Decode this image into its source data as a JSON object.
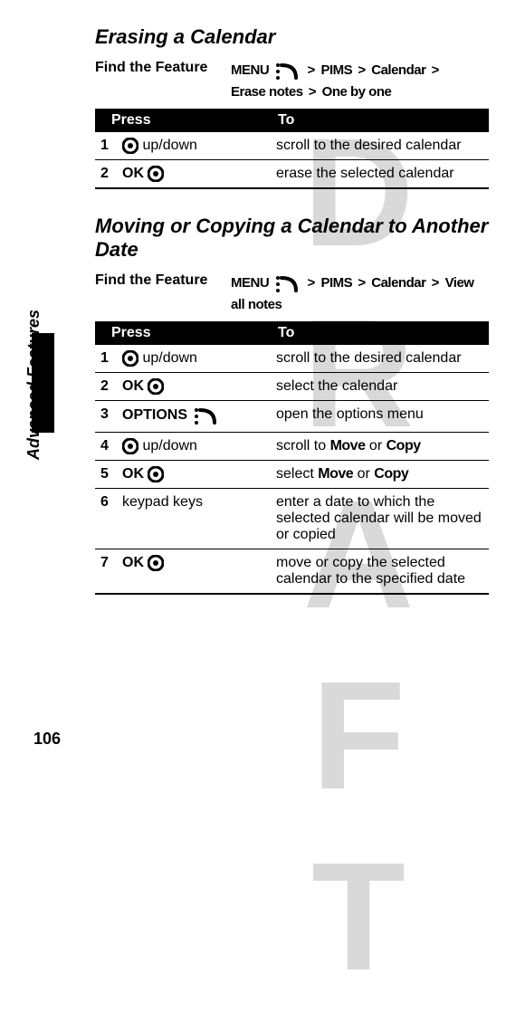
{
  "watermark": "DRAFT",
  "sideLabel": "Advanced Features",
  "pageNumber": "106",
  "section1": {
    "title": "Erasing a Calendar",
    "findLabel": "Find the Feature",
    "path": {
      "menu": "MENU",
      "p1": "PIMS",
      "p2": "Calendar",
      "p3": "Erase notes",
      "p4": "One by one"
    },
    "headers": {
      "press": "Press",
      "to": "To"
    },
    "rows": [
      {
        "n": "1",
        "press": "up/down",
        "icon": "center",
        "to": "scroll to the desired calendar"
      },
      {
        "n": "2",
        "press": "OK",
        "icon": "center-after",
        "to": "erase the selected calendar"
      }
    ]
  },
  "section2": {
    "title": "Moving or Copying a Calendar to Another Date",
    "findLabel": "Find the Feature",
    "path": {
      "menu": "MENU",
      "p1": "PIMS",
      "p2": "Calendar",
      "p3": "View all notes"
    },
    "headers": {
      "press": "Press",
      "to": "To"
    },
    "rows": [
      {
        "n": "1",
        "pressPre": "",
        "press": "up/down",
        "icon": "center",
        "to": "scroll to the desired calendar"
      },
      {
        "n": "2",
        "press": "OK",
        "icon": "center-after",
        "to": "select the calendar"
      },
      {
        "n": "3",
        "press": "OPTIONS",
        "icon": "menu-after",
        "to": "open the options menu"
      },
      {
        "n": "4",
        "press": "up/down",
        "icon": "center",
        "toPre": "scroll to ",
        "toB1": "Move",
        "toMid": " or ",
        "toB2": "Copy"
      },
      {
        "n": "5",
        "press": "OK",
        "icon": "center-after",
        "toPre": "select ",
        "toB1": "Move",
        "toMid": " or ",
        "toB2": "Copy"
      },
      {
        "n": "6",
        "press": "keypad keys",
        "icon": "none",
        "to": "enter a date to which the selected calendar will be moved or copied"
      },
      {
        "n": "7",
        "press": "OK",
        "icon": "center-after",
        "to": "move or copy the selected calendar to the specified date"
      }
    ]
  }
}
